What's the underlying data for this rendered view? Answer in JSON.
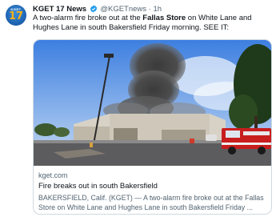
{
  "account": {
    "name": "KGET 17 News",
    "handle": "@KGETnews",
    "separator": "·",
    "time": "1h",
    "avatar_label": "KGET",
    "avatar_number": "17",
    "verified_icon": "verified-badge-icon"
  },
  "tweet": {
    "text_before": "A two-alarm fire broke out at the ",
    "text_bold": "Fallas Store",
    "text_after": " on White Lane and Hughes Lane in south Bakersfield Friday morning. SEE IT:"
  },
  "card": {
    "domain": "kget.com",
    "title": "Fire breaks out in south Bakersfield",
    "description": "BAKERSFIELD, Calif. (KGET) — A two-alarm fire broke out at the Fallas Store on White Lane and Hughes Lane in south Bakersfield Friday ..."
  },
  "colors": {
    "link": "#1d9bf0",
    "text": "#0f1419",
    "muted": "#536471",
    "border": "#cfd9de"
  }
}
